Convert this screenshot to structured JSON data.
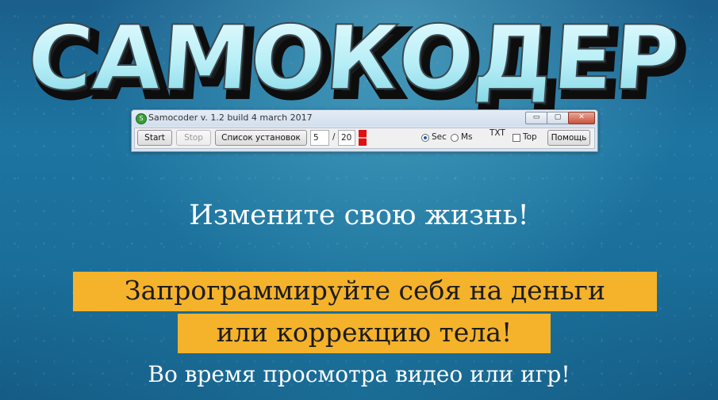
{
  "logo": {
    "text": "САМОКОДЕР"
  },
  "window": {
    "title": "Samocoder v. 1.2 build 4 march 2017",
    "controls": {
      "minimize": "▭",
      "maximize": "▢",
      "close": "✕"
    },
    "toolbar": {
      "start_label": "Start",
      "stop_label": "Stop",
      "presets_label": "Список установок",
      "current_value": "5",
      "separator": "/",
      "total_value": "20",
      "unit_sec_label": "Sec",
      "unit_ms_label": "Ms",
      "unit_selected": "Sec",
      "txt_label": "TXT",
      "top_label": "Top",
      "top_checked": false,
      "help_label": "Помощь"
    }
  },
  "promo": {
    "headline": "Измените свою жизнь!",
    "banner_line1": "Запрограммируйте себя на деньги",
    "banner_line2": "или коррекцию тела!",
    "footer": "Во время просмотра видео или игр!"
  },
  "colors": {
    "banner": "#f5b22b",
    "indicator": "#e01010",
    "background": "#1d74a0"
  }
}
